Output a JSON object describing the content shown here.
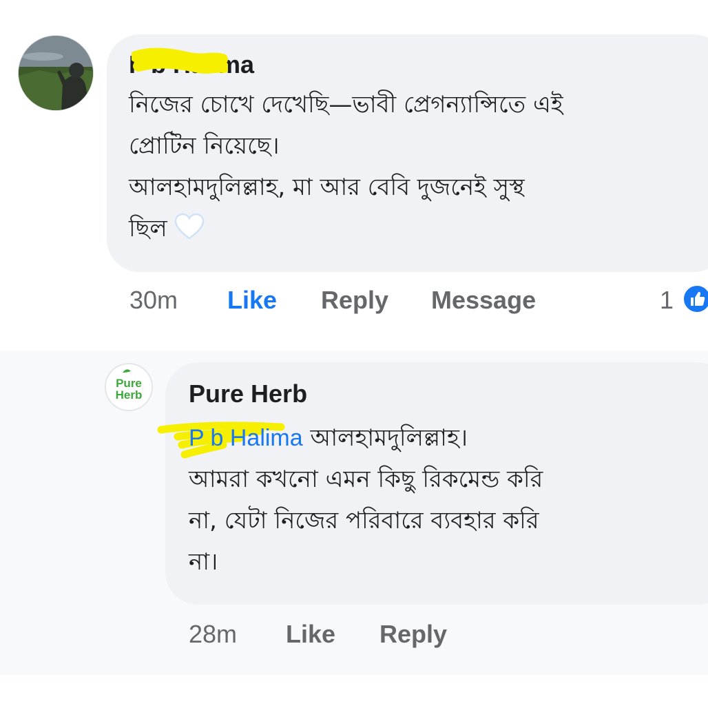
{
  "comment": {
    "author": "F     b Halima",
    "lines": [
      "নিজের চোখে দেখেছি—ভাবী প্রেগন্যান্সিতে এই",
      "প্রোটিন নিয়েছে।",
      "আলহামদুলিল্লাহ, মা আর বেবি দুজনেই সুস্থ",
      "ছিল"
    ],
    "emoji_icon": "white-heart-icon",
    "time": "30m",
    "like_label": "Like",
    "reply_label": "Reply",
    "message_label": "Message",
    "reaction_count": "1",
    "reaction_icon": "like-icon"
  },
  "reply": {
    "author": "Pure Herb",
    "avatar_text_line1": "Pure",
    "avatar_text_line2": "Herb",
    "mention": "P     b Halima",
    "first_line_rest": " আলহামদুলিল্লাহ।",
    "lines": [
      "আমরা কখনো এমন কিছু রিকমেন্ড করি",
      "না, যেটা নিজের পরিবারে ব্যবহার করি",
      "না।"
    ],
    "time": "28m",
    "like_label": "Like",
    "reply_label": "Reply"
  },
  "colors": {
    "bubble": "#f0f2f5",
    "like_active": "#1877f2",
    "meta_text": "#65676b",
    "redaction": "#f7ef00",
    "brand_green": "#3aa83a"
  }
}
